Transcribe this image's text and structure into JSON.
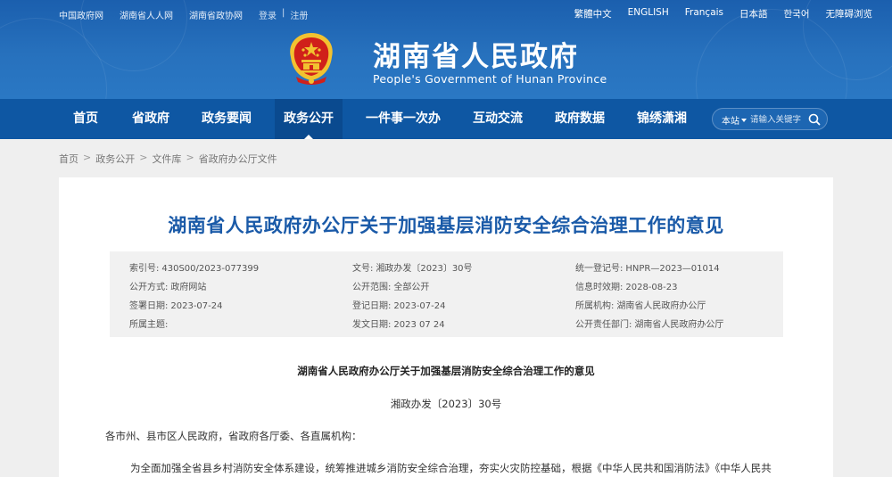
{
  "topbar": {
    "left_links": [
      "中国政府网",
      "湖南省人人网",
      "湖南省政协网"
    ],
    "login": "登录",
    "divider": "|",
    "register": "注册",
    "languages": [
      "繁體中文",
      "ENGLISH",
      "Français",
      "日本語",
      "한국어",
      "无障碍浏览"
    ]
  },
  "header": {
    "title": "湖南省人民政府",
    "subtitle": "People's Government of Hunan Province"
  },
  "nav": {
    "items": [
      "首页",
      "省政府",
      "政务要闻",
      "政务公开",
      "一件事一次办",
      "互动交流",
      "政府数据",
      "锦绣潇湘"
    ],
    "active_index": 3
  },
  "search": {
    "scope": "本站",
    "placeholder": "请输入关键字"
  },
  "breadcrumb": [
    "首页",
    "政务公开",
    "文件库",
    "省政府办公厅文件"
  ],
  "breadcrumb_sep": ">",
  "document": {
    "title": "湖南省人民政府办公厅关于加强基层消防安全综合治理工作的意见",
    "meta": [
      {
        "label": "索引号:",
        "value": "430S00/2023-077399"
      },
      {
        "label": "文号:",
        "value": "湘政办发〔2023〕30号"
      },
      {
        "label": "统一登记号:",
        "value": "HNPR—2023—01014"
      },
      {
        "label": "公开方式:",
        "value": "政府网站"
      },
      {
        "label": "公开范围:",
        "value": "全部公开"
      },
      {
        "label": "信息时效期:",
        "value": "2028-08-23"
      },
      {
        "label": "签署日期:",
        "value": "2023-07-24"
      },
      {
        "label": "登记日期:",
        "value": "2023-07-24"
      },
      {
        "label": "所属机构:",
        "value": "湖南省人民政府办公厅"
      },
      {
        "label": "所属主题:",
        "value": ""
      },
      {
        "label": "发文日期:",
        "value": "2023 07 24"
      },
      {
        "label": "公开责任部门:",
        "value": "湖南省人民政府办公厅"
      }
    ],
    "body_title": "湖南省人民政府办公厅关于加强基层消防安全综合治理工作的意见",
    "doc_number": "湘政办发〔2023〕30号",
    "addressee": "各市州、县市区人民政府，省政府各厅委、各直属机构：",
    "paragraph": "为全面加强全省县乡村消防安全体系建设，统筹推进城乡消防安全综合治理，夯实火灾防控基础，根据《中华人民共和国消防法》《中华人民共"
  },
  "colors": {
    "header_blue": "#2771bd",
    "nav_blue": "#0e57a3",
    "title_blue": "#1a5aa8",
    "emblem_red": "#d0201a",
    "emblem_gold": "#f2c230"
  }
}
